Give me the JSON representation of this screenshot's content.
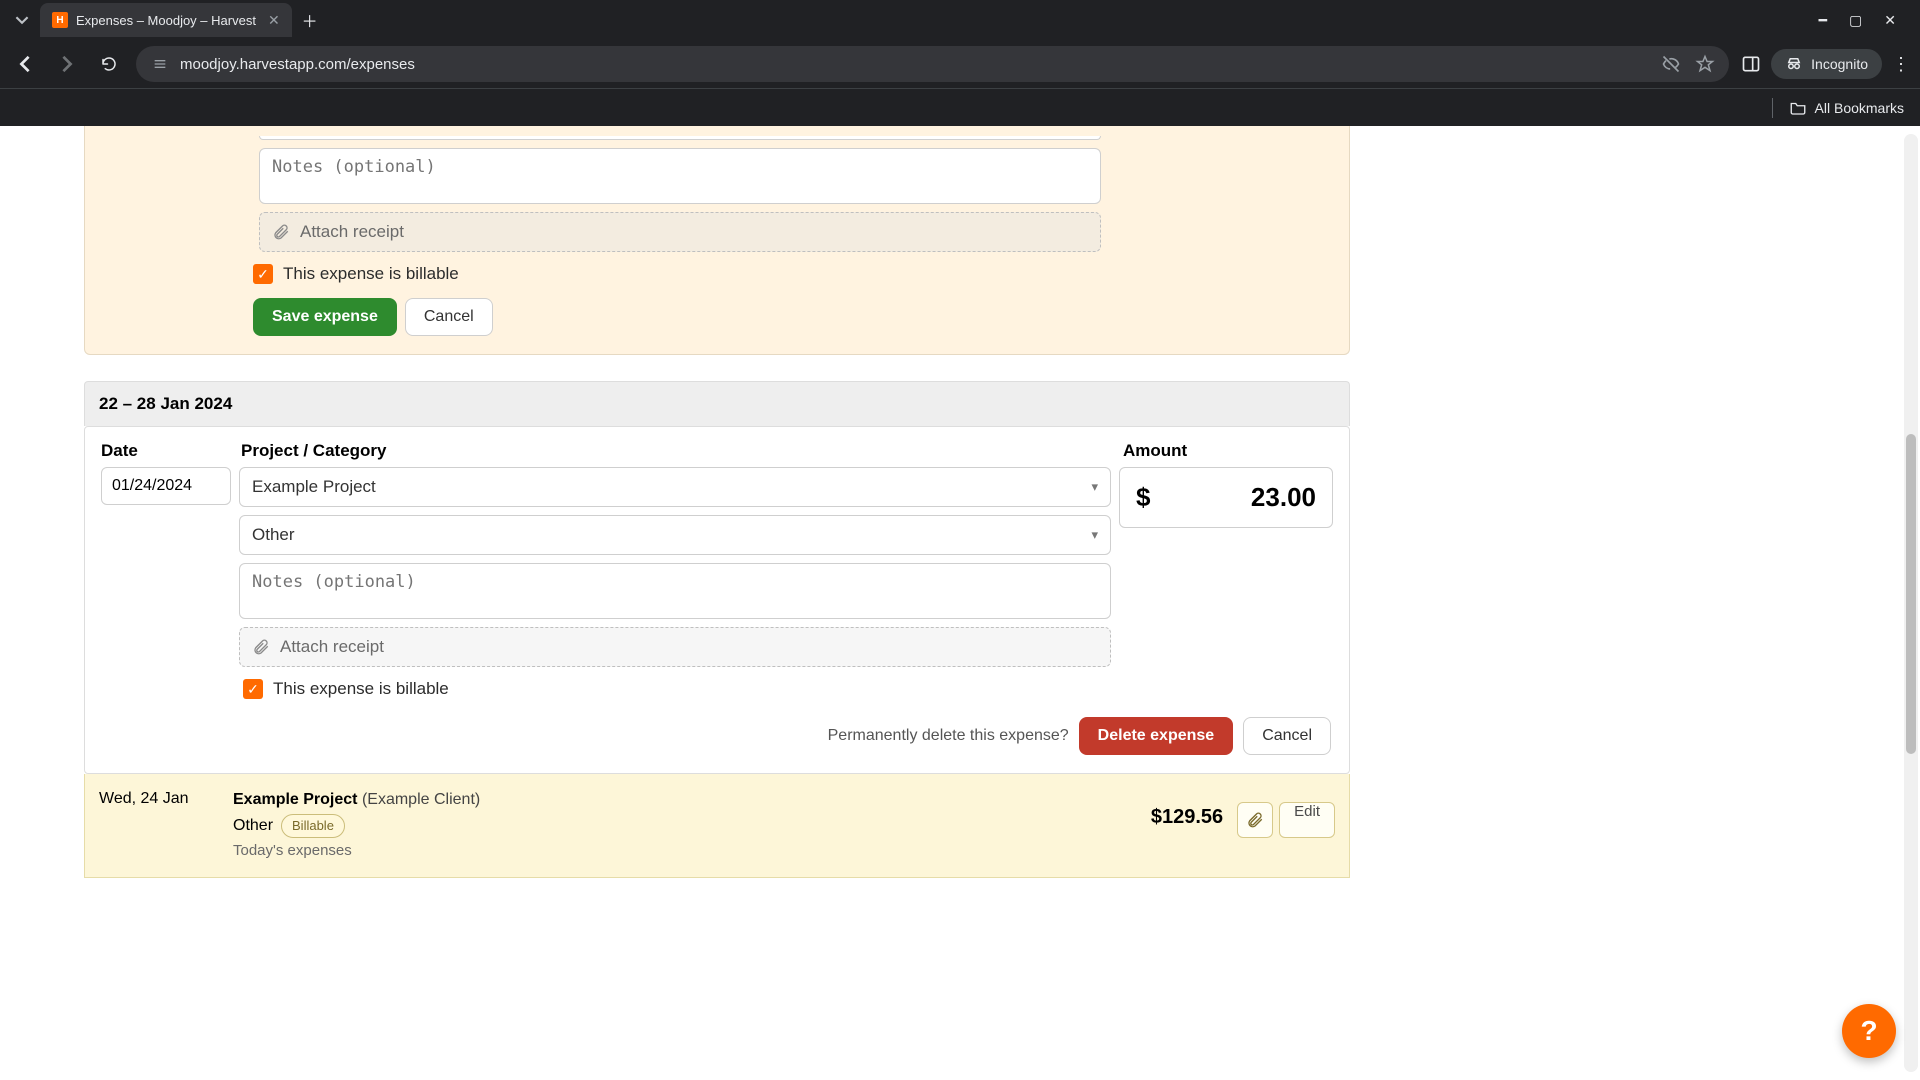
{
  "browser": {
    "tab_title": "Expenses – Moodjoy – Harvest",
    "url": "moodjoy.harvestapp.com/expenses",
    "incognito_label": "Incognito",
    "all_bookmarks": "All Bookmarks"
  },
  "form_top": {
    "notes_placeholder": "Notes (optional)",
    "attach_label": "Attach receipt",
    "billable_label": "This expense is billable",
    "save_label": "Save expense",
    "cancel_label": "Cancel"
  },
  "section": {
    "range": "22 – 28 Jan 2024",
    "columns": {
      "date": "Date",
      "project": "Project / Category",
      "amount": "Amount"
    }
  },
  "edit_form": {
    "date": "01/24/2024",
    "project": "Example Project",
    "category": "Other",
    "notes_placeholder": "Notes (optional)",
    "attach_label": "Attach receipt",
    "billable_label": "This expense is billable",
    "amount_currency": "$",
    "amount_value": "23.00",
    "delete_prompt": "Permanently delete this expense?",
    "delete_label": "Delete expense",
    "cancel_label": "Cancel"
  },
  "list_row": {
    "date": "Wed, 24 Jan",
    "project": "Example Project",
    "client": "(Example Client)",
    "category": "Other",
    "billable_badge": "Billable",
    "notes": "Today's expenses",
    "amount": "$129.56",
    "edit_label": "Edit"
  },
  "help_fab": "?"
}
